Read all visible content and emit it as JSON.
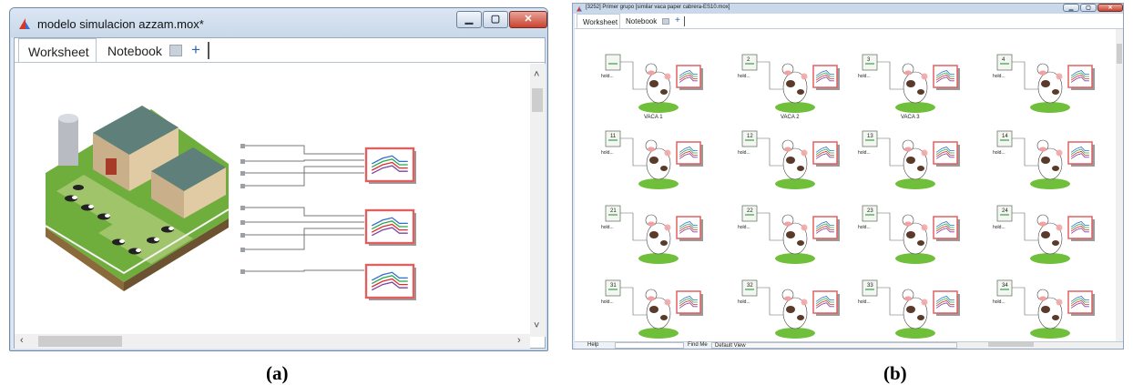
{
  "panel_a": {
    "caption": "(a)",
    "title": "modelo simulacion azzam.mox*",
    "tabs": [
      {
        "label": "Worksheet",
        "active": true
      },
      {
        "label": "Notebook",
        "active": false
      }
    ],
    "add_tab_symbol": "+",
    "graph_count": 3,
    "colors": {
      "graph_border": "#e06060",
      "graph_lines": [
        "#2f6fd0",
        "#2aa84a",
        "#d83030",
        "#8040a0"
      ],
      "wire": "#777777"
    }
  },
  "panel_b": {
    "caption": "(b)",
    "title": "[3252] Primer grupo [similar vaca paper cabrera-ES10.mox]",
    "tabs": [
      {
        "label": "Worksheet",
        "active": true
      },
      {
        "label": "Notebook",
        "active": false
      }
    ],
    "add_tab_symbol": "+",
    "hold_label": "hold...",
    "rows": [
      {
        "blocks": [
          {
            "number": "",
            "cow_label": "VACA 1"
          },
          {
            "number": "2",
            "cow_label": "VACA 2"
          },
          {
            "number": "3",
            "cow_label": "VACA 3"
          },
          {
            "number": "4",
            "cow_label": ""
          }
        ]
      },
      {
        "blocks": [
          {
            "number": "11",
            "cow_label": ""
          },
          {
            "number": "12",
            "cow_label": ""
          },
          {
            "number": "13",
            "cow_label": ""
          },
          {
            "number": "14",
            "cow_label": ""
          }
        ]
      },
      {
        "blocks": [
          {
            "number": "21",
            "cow_label": ""
          },
          {
            "number": "22",
            "cow_label": ""
          },
          {
            "number": "23",
            "cow_label": ""
          },
          {
            "number": "24",
            "cow_label": ""
          }
        ]
      },
      {
        "blocks": [
          {
            "number": "31",
            "cow_label": ""
          },
          {
            "number": "32",
            "cow_label": ""
          },
          {
            "number": "33",
            "cow_label": ""
          },
          {
            "number": "34",
            "cow_label": ""
          }
        ]
      }
    ],
    "statusbar": {
      "help_label": "Help",
      "find_label": "Find Me",
      "view_label": "Default View"
    }
  }
}
